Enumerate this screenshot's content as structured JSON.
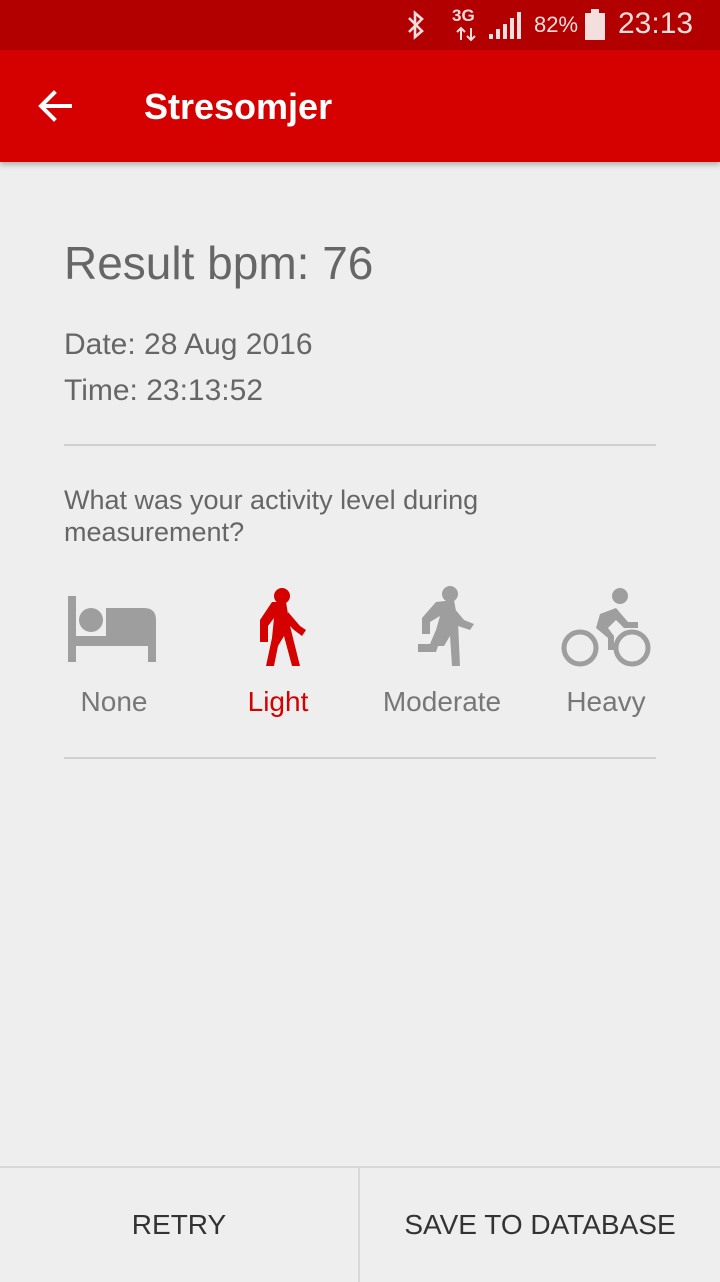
{
  "status_bar": {
    "network": "3G",
    "battery": "82%",
    "time": "23:13",
    "icons": [
      "bluetooth-icon",
      "network-3g-icon",
      "signal-icon",
      "battery-icon"
    ]
  },
  "app_bar": {
    "title": "Stresomjer",
    "back_icon": "arrow-left-icon",
    "color": "#d50000"
  },
  "result": {
    "text": "Result bpm: 76",
    "date": "Date: 28 Aug 2016",
    "time": "Time: 23:13:52"
  },
  "activity": {
    "question": "What was your activity level during measurement?",
    "options": [
      {
        "label": "None",
        "icon": "bed-icon",
        "selected": false
      },
      {
        "label": "Light",
        "icon": "walk-icon",
        "selected": true
      },
      {
        "label": "Moderate",
        "icon": "run-icon",
        "selected": false
      },
      {
        "label": "Heavy",
        "icon": "bike-icon",
        "selected": false
      }
    ],
    "selected_color": "#d50000",
    "unselected_color": "#9e9e9e"
  },
  "actions": {
    "retry": "RETRY",
    "save": "SAVE TO DATABASE"
  }
}
